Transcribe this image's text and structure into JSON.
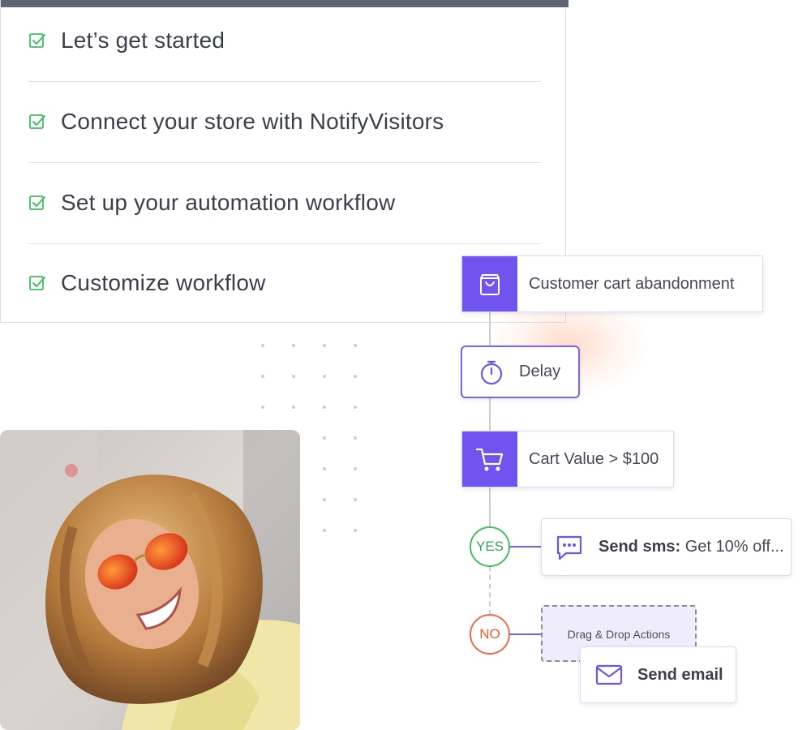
{
  "checklist": {
    "items": [
      {
        "label": "Let’s get started",
        "checked": true
      },
      {
        "label": "Connect your store with NotifyVisitors",
        "checked": true
      },
      {
        "label": "Set up your automation workflow",
        "checked": true
      },
      {
        "label": "Customize workflow",
        "checked": true
      }
    ]
  },
  "workflow": {
    "trigger": {
      "label": "Customer cart abandonment",
      "icon": "shopping-bag-icon"
    },
    "delay": {
      "label": "Delay",
      "icon": "stopwatch-icon"
    },
    "condition": {
      "label": "Cart Value > $100",
      "icon": "shopping-cart-icon"
    },
    "yes_branch": {
      "badge": "YES",
      "action_bold": "Send sms:",
      "action_rest": "Get 10% off...",
      "icon": "chat-bubble-icon"
    },
    "no_branch": {
      "badge": "NO",
      "dropzone_label": "Drag & Drop Actions",
      "dragged_action": "Send email",
      "icon": "envelope-icon"
    }
  },
  "colors": {
    "accent_purple": "#6f54f0",
    "check_green": "#3fbf62",
    "yes_green": "#3fbf62",
    "no_orange": "#f06a43"
  }
}
